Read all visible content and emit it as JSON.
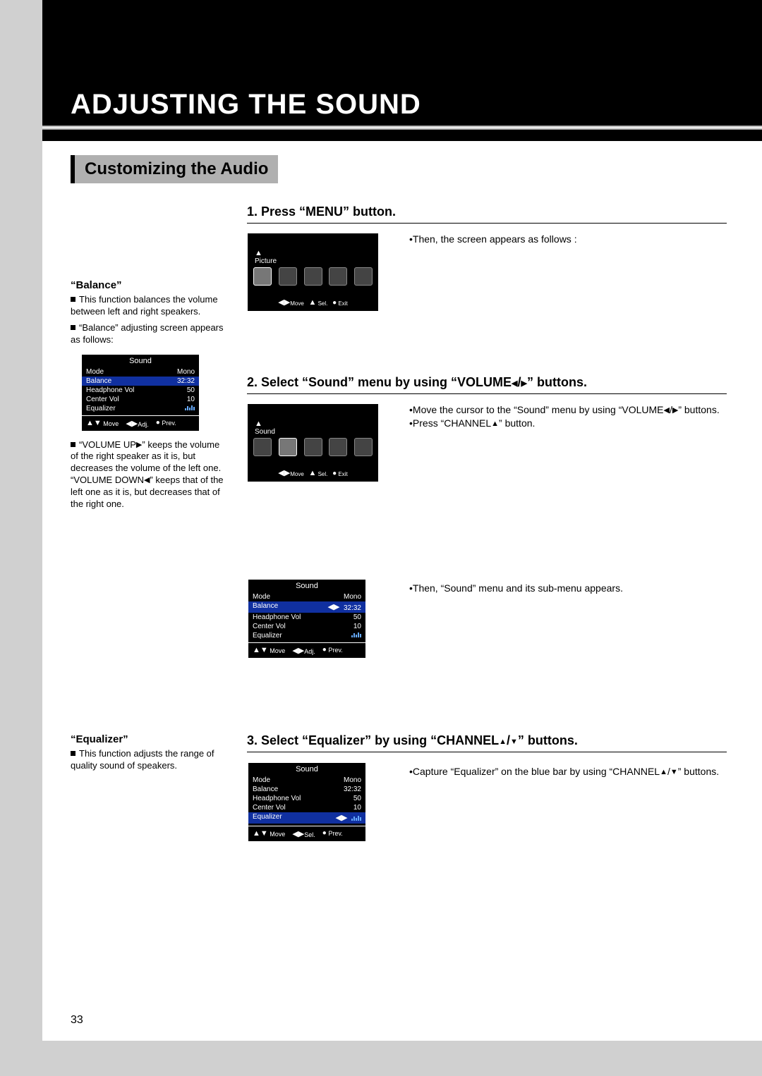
{
  "page_number": "33",
  "title": "ADJUSTING THE SOUND",
  "subtitle": "Customizing the Audio",
  "steps": {
    "s1": {
      "heading": "1. Press “MENU” button.",
      "bullet1": "•Then, the screen appears as follows :"
    },
    "s2": {
      "heading_pre": "2. Select “Sound” menu by using “VOLUME",
      "heading_post": "” buttons.",
      "b1_pre": "•Move the cursor to the “Sound” menu by using “VOLUME",
      "b1_post": "” buttons.",
      "b2_pre": "•Press “CHANNEL",
      "b2_post": "” button.",
      "b3": "•Then, “Sound” menu and its sub-menu appears."
    },
    "s3": {
      "heading_pre": "3. Select “Equalizer” by using “CHANNEL",
      "heading_post": "” buttons.",
      "b1_pre": "•Capture “Equalizer” on the blue bar by using “CHANNEL",
      "b1_post": "” buttons."
    }
  },
  "sidebar": {
    "balance": {
      "title": "“Balance”",
      "t1": "This function balances the volume between left and right speakers.",
      "t2": "“Balance” adjusting screen appears as follows:",
      "t3_pre": "“VOLUME UP",
      "t3_mid": "” keeps the volume of the right speaker as it is, but decreases the volume of the left one. “VOLUME DOWN",
      "t3_post": "” keeps that of the left one as it is, but decreases that of the right one."
    },
    "equalizer": {
      "title": "“Equalizer”",
      "t1": "This function adjusts the range of quality sound of speakers."
    }
  },
  "osd": {
    "title_sound": "Sound",
    "title_picture": "Picture",
    "mode_label": "Mode",
    "mode_val": "Mono",
    "balance_label": "Balance",
    "balance_val": "32:32",
    "hp_label": "Headphone Vol",
    "hp_val": "50",
    "cv_label": "Center Vol",
    "cv_val": "10",
    "eq_label": "Equalizer",
    "foot_move": "Move",
    "foot_adj": "Adj.",
    "foot_sel": "Sel.",
    "foot_prev": "Prev.",
    "foot_exit": "Exit"
  }
}
